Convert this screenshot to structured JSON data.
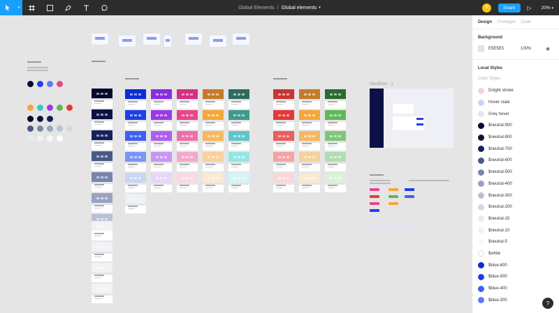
{
  "toolbar": {
    "project": "Global Elements",
    "separator": "/",
    "page": "Global elements",
    "avatar_initial": "R",
    "share": "Share",
    "zoom": "20%"
  },
  "panel": {
    "tabs": [
      "Design",
      "Prototype",
      "Code"
    ],
    "background_title": "Background",
    "bg_hex": "E5E5E5",
    "bg_opacity": "100%",
    "local_styles_title": "Local Styles",
    "color_styles_title": "Color Styles",
    "styles": [
      {
        "name": "Dotght stroke",
        "color": "#f3d2d9"
      },
      {
        "name": "Hover state",
        "color": "#c9d5f5"
      },
      {
        "name": "Grey hover",
        "color": "#e4e6ef"
      },
      {
        "name": "$neutral-900",
        "color": "#06082e"
      },
      {
        "name": "$neutral-800",
        "color": "#0c1246"
      },
      {
        "name": "$neutral-700",
        "color": "#16205a"
      },
      {
        "name": "$neutral-600",
        "color": "#4a5a86"
      },
      {
        "name": "$neutral-500",
        "color": "#7986ab"
      },
      {
        "name": "$neutral-400",
        "color": "#9aa3c1"
      },
      {
        "name": "$neutral-300",
        "color": "#b9c0d6"
      },
      {
        "name": "$neutral-200",
        "color": "#d3d8e6"
      },
      {
        "name": "$neutral-15",
        "color": "#e9ebf2"
      },
      {
        "name": "$neutral-10",
        "color": "#f1f2f6"
      },
      {
        "name": "$neutral-5",
        "color": "#f7f8fa"
      },
      {
        "name": "$white",
        "color": "#ffffff"
      },
      {
        "name": "$blue-600",
        "color": "#0a2ed6"
      },
      {
        "name": "$blue-500",
        "color": "#1f3fe6"
      },
      {
        "name": "$blue-400",
        "color": "#3f5ff0"
      },
      {
        "name": "$blue-300",
        "color": "#5e7af4"
      }
    ]
  },
  "canvas": {
    "frame_title": "MacBook - 1",
    "help": "?"
  },
  "colors": {
    "accent": "#18a0fb",
    "toolbar_bg": "#2c2c2c",
    "canvas_bg": "#e5e5e5"
  }
}
